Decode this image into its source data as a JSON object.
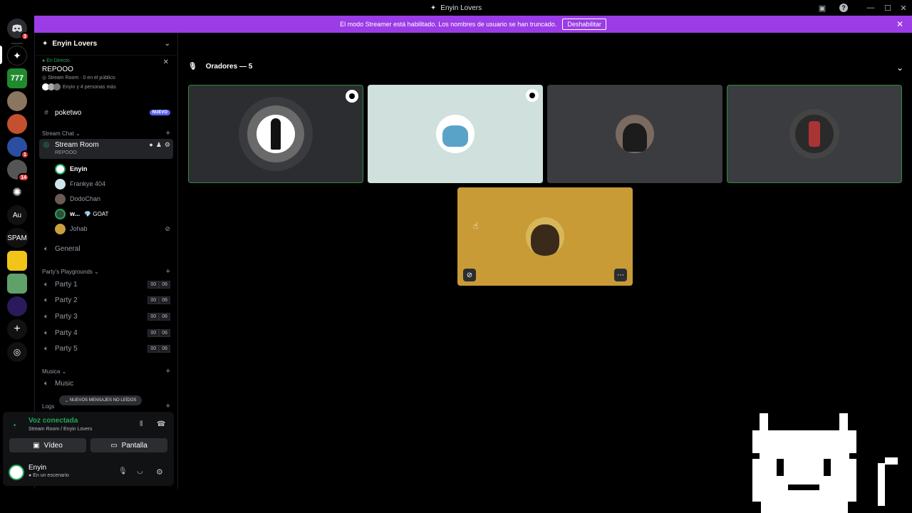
{
  "window": {
    "title": "Enyin Lovers"
  },
  "banner": {
    "text": "El modo Streamer está habilitado. Los nombres de usuario se han truncado.",
    "button": "Deshabilitar"
  },
  "guilds": [
    {
      "label": "",
      "badge": "3"
    },
    {
      "label": "",
      "badge": ""
    },
    {
      "label": "777",
      "badge": ""
    },
    {
      "label": "",
      "badge": ""
    },
    {
      "label": "",
      "badge": ""
    },
    {
      "label": "",
      "badge": "1"
    },
    {
      "label": "",
      "badge": "14"
    },
    {
      "label": "",
      "badge": ""
    },
    {
      "label": "Au",
      "badge": ""
    },
    {
      "label": "SPAM",
      "badge": ""
    }
  ],
  "sidebar": {
    "server_name": "Enyin Lovers",
    "live": {
      "status": "En Directo",
      "stage_name": "REPOOO",
      "info": "Stream Room · 0 en el público",
      "audience": "Enyin y 4 personas más"
    },
    "pinned_channel": {
      "name": "poketwo",
      "badge": "NUEVO"
    },
    "categories": {
      "stream_chat": "Stream Chat",
      "playgrounds": "Party's Playgrounds",
      "musica": "Musica",
      "logs": "Logs"
    },
    "stream_room": {
      "name": "Stream Room",
      "sub": "REPOOO"
    },
    "members": [
      {
        "name": "Enyin",
        "tag": ""
      },
      {
        "name": "Frankye 404",
        "tag": ""
      },
      {
        "name": "DodoChan",
        "tag": ""
      },
      {
        "name": "w...",
        "tag": "💎 GOAT"
      },
      {
        "name": "Johab",
        "tag": ""
      }
    ],
    "general": "General",
    "parties": [
      {
        "name": "Party 1",
        "a": "00",
        "b": "06"
      },
      {
        "name": "Party 2",
        "a": "00",
        "b": "06"
      },
      {
        "name": "Party 3",
        "a": "00",
        "b": "06"
      },
      {
        "name": "Party 4",
        "a": "00",
        "b": "06"
      },
      {
        "name": "Party 5",
        "a": "00",
        "b": "06"
      }
    ],
    "music": "Music",
    "unread_pill": "NUEVOS MENSAJES NO LEÍDOS"
  },
  "voice": {
    "status": "Voz conectada",
    "location": "Stream Room / Enyin Lovers",
    "video": "Vídeo",
    "screen": "Pantalla"
  },
  "user": {
    "name": "Enyin",
    "status": "En un escenario"
  },
  "stage": {
    "speakers_title": "Oradores — 5"
  },
  "colors": {
    "banner": "#9b3ce6",
    "green": "#23a55a",
    "tile_speaking": "#2f8a3c"
  }
}
